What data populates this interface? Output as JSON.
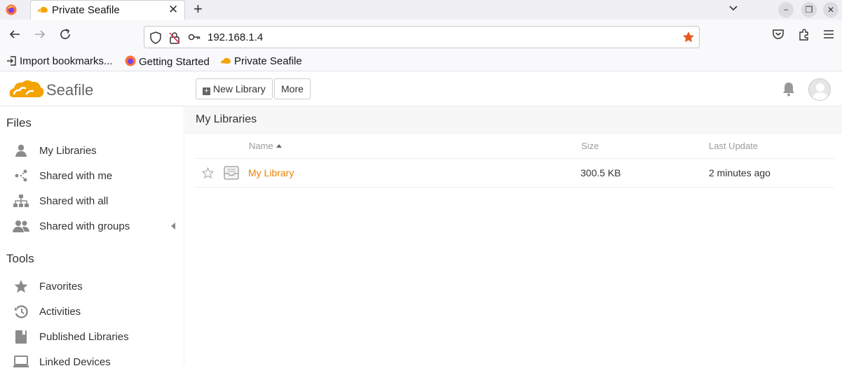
{
  "browser": {
    "tab_title": "Private Seafile",
    "new_tab_icon": "plus-icon",
    "url": "192.168.1.4",
    "bookmarks": [
      "Import bookmarks...",
      "Getting Started",
      "Private Seafile"
    ]
  },
  "header": {
    "logo_text": "Seafile",
    "new_library_label": "New Library",
    "more_label": "More"
  },
  "sidebar": {
    "files_heading": "Files",
    "files_items": [
      {
        "label": "My Libraries",
        "icon": "user-icon"
      },
      {
        "label": "Shared with me",
        "icon": "share-icon"
      },
      {
        "label": "Shared with all",
        "icon": "sitemap-icon"
      },
      {
        "label": "Shared with groups",
        "icon": "group-icon"
      }
    ],
    "tools_heading": "Tools",
    "tools_items": [
      {
        "label": "Favorites",
        "icon": "star-icon"
      },
      {
        "label": "Activities",
        "icon": "history-icon"
      },
      {
        "label": "Published Libraries",
        "icon": "book-icon"
      },
      {
        "label": "Linked Devices",
        "icon": "laptop-icon"
      }
    ]
  },
  "main": {
    "title": "My Libraries",
    "columns": {
      "name": "Name",
      "size": "Size",
      "last_update": "Last Update"
    },
    "rows": [
      {
        "name": "My Library",
        "size": "300.5 KB",
        "last_update": "2 minutes ago"
      }
    ]
  },
  "colors": {
    "accent": "#eb8205",
    "bookmark_star": "#e8591c"
  }
}
